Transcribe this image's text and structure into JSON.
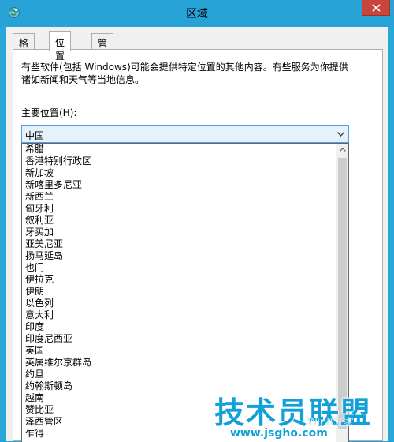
{
  "window": {
    "title": "区域"
  },
  "tabs": [
    {
      "label": "格式",
      "active": false
    },
    {
      "label": "位置",
      "active": true
    },
    {
      "label": "管理",
      "active": false
    }
  ],
  "location": {
    "description_line1": "有些软件(包括 Windows)可能会提供特定位置的其他内容。有些服务为你提供",
    "description_line2": "诸如新闻和天气等当地信息。",
    "home_location_label": "主要位置(H):",
    "selected": "中国",
    "options": [
      "希腊",
      "香港特别行政区",
      "新加坡",
      "新喀里多尼亚",
      "新西兰",
      "匈牙利",
      "叙利亚",
      "牙买加",
      "亚美尼亚",
      "扬马延岛",
      "也门",
      "伊拉克",
      "伊朗",
      "以色列",
      "意大利",
      "印度",
      "印度尼西亚",
      "英国",
      "英属维尔京群岛",
      "约旦",
      "约翰斯顿岛",
      "越南",
      "赞比亚",
      "泽西管区",
      "乍得"
    ],
    "scroll_position": 0.97
  },
  "watermark": {
    "brand": "技术员联盟",
    "url": "www.jsgho.com",
    "side_text": "Win8之家"
  },
  "colors": {
    "titlebar": "#27a2d6",
    "close_button": "#c7453a",
    "combo_highlight": "#e5f1fb",
    "watermark": "#12a0d8"
  },
  "icons": {
    "app_icon": "region-globe-icon",
    "close": "close-icon",
    "dropdown_arrow": "chevron-down-icon",
    "scroll_up": "chevron-up-icon"
  }
}
